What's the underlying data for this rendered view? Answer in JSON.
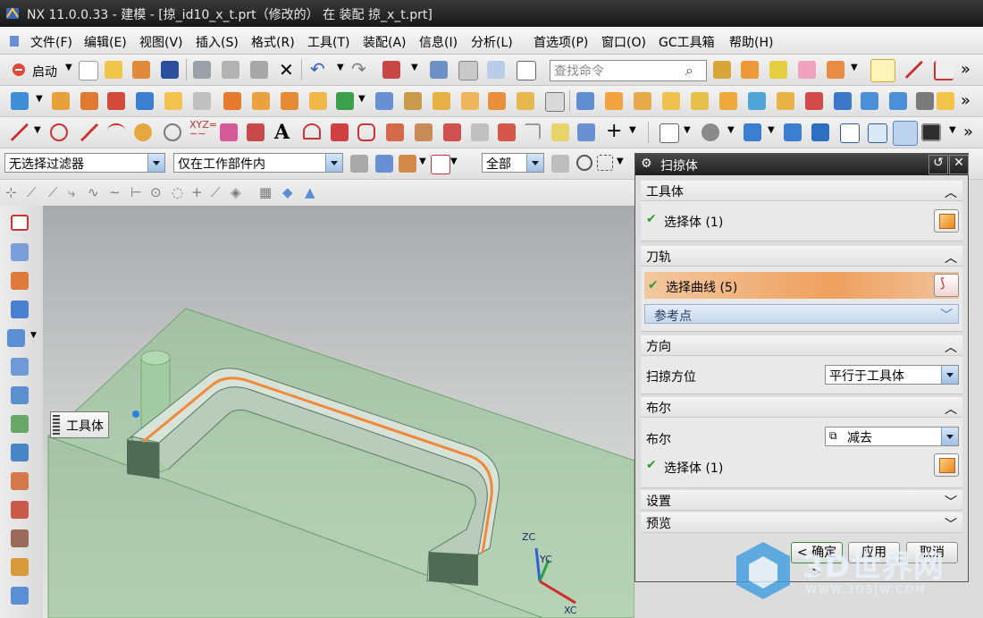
{
  "window": {
    "title": "NX 11.0.0.33 - 建模 - [掠_id10_x_t.prt（修改的） 在 装配 掠_x_t.prt]"
  },
  "menubar": {
    "items": [
      "文件(F)",
      "编辑(E)",
      "视图(V)",
      "插入(S)",
      "格式(R)",
      "工具(T)",
      "装配(A)",
      "信息(I)",
      "分析(L)",
      "首选项(P)",
      "窗口(O)",
      "GC工具箱",
      "帮助(H)"
    ]
  },
  "toolbar": {
    "start_label": "启动",
    "search_placeholder": "查找命令"
  },
  "filterbar": {
    "type_filter": "无选择过滤器",
    "scope_filter": "仅在工作部件内",
    "assembly_filter": "全部"
  },
  "viewport": {
    "tooltip_label": "工具体",
    "axes": {
      "z": "ZC",
      "y": "YC",
      "x": "XC"
    }
  },
  "dialog": {
    "title": "扫掠体",
    "sections": {
      "tool": {
        "header": "工具体",
        "select_label": "选择体 (1)"
      },
      "path": {
        "header": "刀轨",
        "select_label": "选择曲线 (5)",
        "ref_point": "参考点"
      },
      "direction": {
        "header": "方向",
        "orientation_label": "扫掠方位",
        "orientation_value": "平行于工具体"
      },
      "boolean": {
        "header": "布尔",
        "boolean_label": "布尔",
        "boolean_value": "减去",
        "select_label": "选择体 (1)"
      },
      "settings": {
        "header": "设置"
      },
      "preview": {
        "header": "预览"
      }
    },
    "buttons": {
      "ok": "< 确定 >",
      "apply": "应用",
      "cancel": "取消"
    }
  },
  "watermark": {
    "name": "3D世界网",
    "url": "WWW.3DSJW.COM"
  },
  "colors": {
    "accent_orange": "#f0a060",
    "title_dark": "#1e1e1e",
    "model_green": "#7fbf7f",
    "check_green": "#2f9c2f"
  }
}
